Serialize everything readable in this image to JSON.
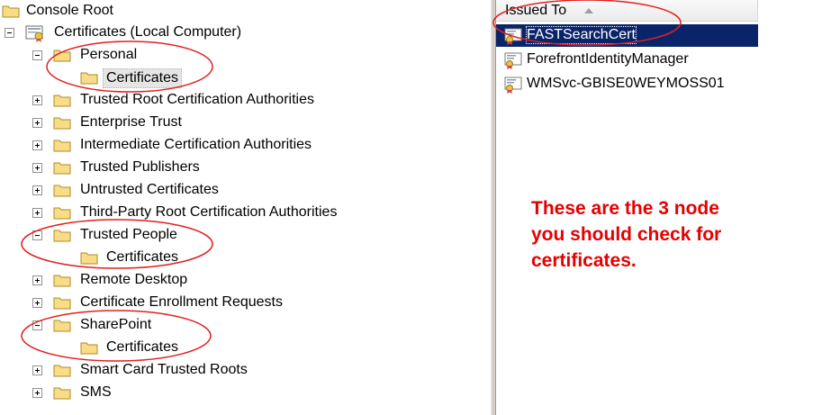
{
  "tree": {
    "items": [
      {
        "label": "Console Root",
        "icon": "folder-icon"
      },
      {
        "label": "Certificates (Local Computer)",
        "icon": "certificate-snapin-icon",
        "expander": "minus"
      },
      {
        "label": "Personal",
        "icon": "folder-icon",
        "expander": "minus"
      },
      {
        "label": "Certificates",
        "icon": "folder-icon",
        "selected": true
      },
      {
        "label": "Trusted Root Certification Authorities",
        "icon": "folder-icon",
        "expander": "plus"
      },
      {
        "label": "Enterprise Trust",
        "icon": "folder-icon",
        "expander": "plus"
      },
      {
        "label": "Intermediate Certification Authorities",
        "icon": "folder-icon",
        "expander": "plus"
      },
      {
        "label": "Trusted Publishers",
        "icon": "folder-icon",
        "expander": "plus"
      },
      {
        "label": "Untrusted Certificates",
        "icon": "folder-icon",
        "expander": "plus"
      },
      {
        "label": "Third-Party Root Certification Authorities",
        "icon": "folder-icon",
        "expander": "plus"
      },
      {
        "label": "Trusted People",
        "icon": "folder-icon",
        "expander": "minus"
      },
      {
        "label": "Certificates",
        "icon": "folder-icon"
      },
      {
        "label": "Remote Desktop",
        "icon": "folder-icon",
        "expander": "plus"
      },
      {
        "label": "Certificate Enrollment Requests",
        "icon": "folder-icon",
        "expander": "plus"
      },
      {
        "label": "SharePoint",
        "icon": "folder-icon",
        "expander": "minus"
      },
      {
        "label": "Certificates",
        "icon": "folder-icon"
      },
      {
        "label": "Smart Card Trusted Roots",
        "icon": "folder-icon",
        "expander": "plus"
      },
      {
        "label": "SMS",
        "icon": "folder-icon",
        "expander": "plus"
      }
    ]
  },
  "list": {
    "column_header": "Issued To",
    "sort": "ascending",
    "rows": [
      {
        "label": "FASTSearchCert",
        "icon": "certificate-icon",
        "selected": true
      },
      {
        "label": "ForefrontIdentityManager",
        "icon": "certificate-icon"
      },
      {
        "label": "WMSvc-GBISE0WEYMOSS01",
        "icon": "certificate-icon"
      }
    ]
  },
  "annotation": {
    "line1": "These are the 3 node",
    "line2": "you should check for",
    "line3": "certificates.",
    "color": "#e60000"
  },
  "colors": {
    "selection": "#0a246a",
    "folder": "#f5d77a",
    "annotation_oval": "#e02020"
  }
}
